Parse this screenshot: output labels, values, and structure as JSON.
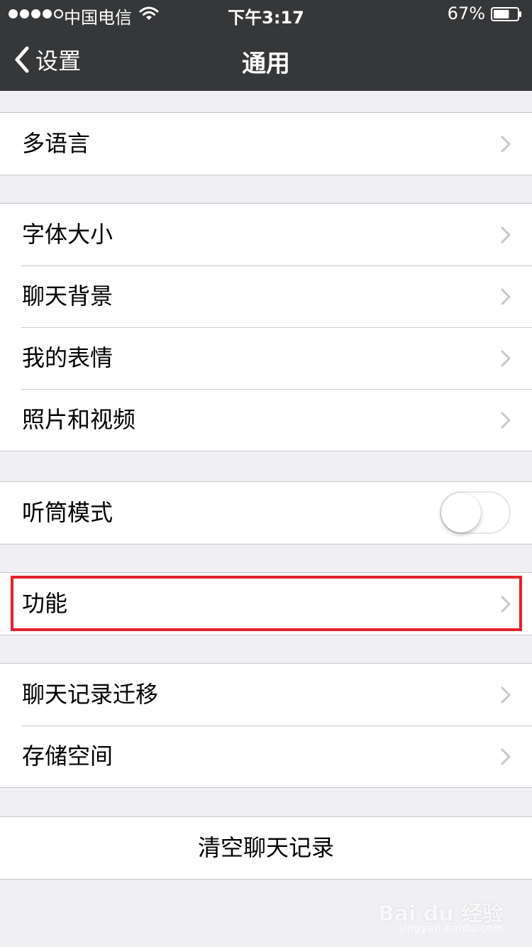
{
  "status_bar": {
    "carrier": "中国电信",
    "time": "下午3:17",
    "battery_percent": "67%",
    "battery_level": 0.67,
    "signal_bars_filled": 4,
    "signal_bars_total": 5
  },
  "nav": {
    "back_label": "设置",
    "title": "通用"
  },
  "groups": {
    "language": {
      "label": "多语言"
    },
    "display": {
      "font_size": "字体大小",
      "chat_background": "聊天背景",
      "my_stickers": "我的表情",
      "photos_videos": "照片和视频"
    },
    "earpiece": {
      "label": "听筒模式",
      "enabled": false
    },
    "features": {
      "label": "功能"
    },
    "storage": {
      "chat_migration": "聊天记录迁移",
      "storage_space": "存储空间"
    },
    "clear": {
      "label": "清空聊天记录"
    }
  },
  "watermark": {
    "text": "Bai du 经验",
    "sub": "jingyan.baidu.com"
  },
  "colors": {
    "nav_bg": "#363739",
    "page_bg": "#efeff4",
    "highlight": "#e4212c",
    "separator": "#c8c7cc",
    "chevron": "#c7c7cc"
  }
}
